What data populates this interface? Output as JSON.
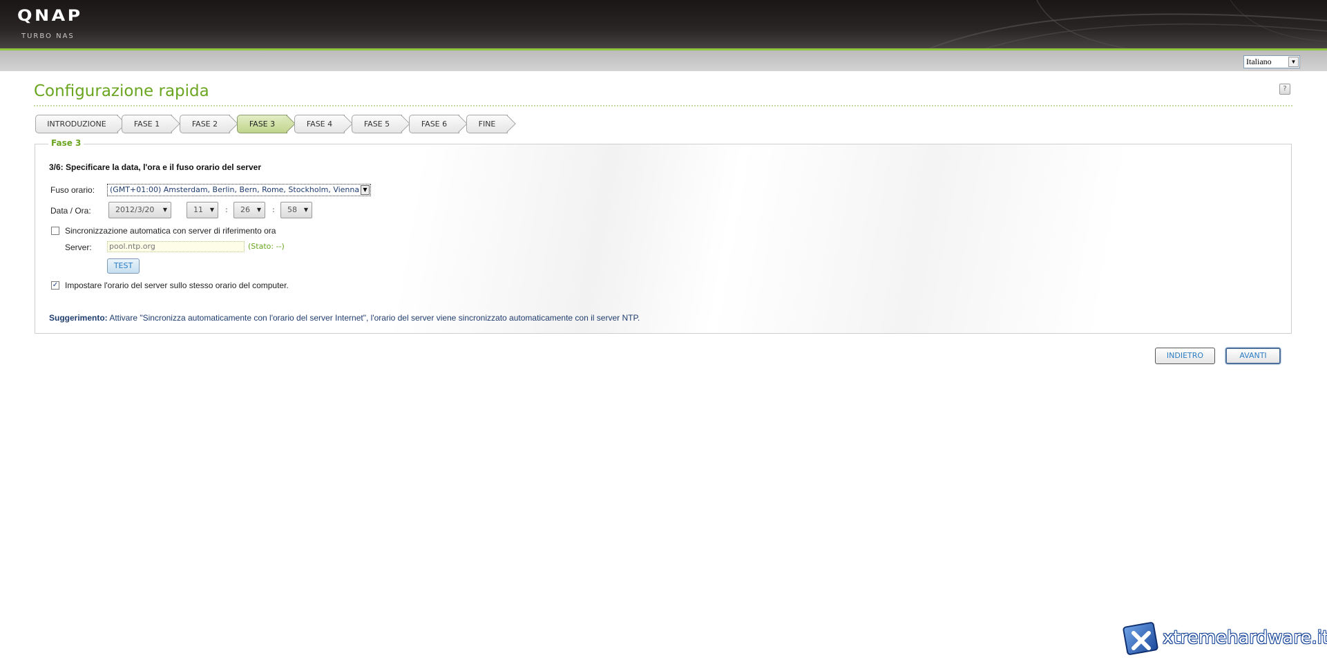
{
  "header": {
    "logo": "QNAP",
    "logo_sub": "TURBO NAS"
  },
  "language": {
    "selected": "Italiano"
  },
  "page_title": "Configurazione rapida",
  "steps": [
    {
      "label": "INTRODUZIONE",
      "active": false
    },
    {
      "label": "FASE 1",
      "active": false
    },
    {
      "label": "FASE 2",
      "active": false
    },
    {
      "label": "FASE 3",
      "active": true
    },
    {
      "label": "FASE 4",
      "active": false
    },
    {
      "label": "FASE 5",
      "active": false
    },
    {
      "label": "FASE 6",
      "active": false
    },
    {
      "label": "FINE",
      "active": false
    }
  ],
  "panel": {
    "legend": "Fase 3",
    "instruction": "3/6: Specificare la data, l'ora e il fuso orario del server",
    "timezone_label": "Fuso orario:",
    "timezone_value": "(GMT+01:00) Amsterdam, Berlin, Bern, Rome, Stockholm, Vienna",
    "datetime_label": "Data / Ora:",
    "date_value": "2012/3/20",
    "hour_value": "11",
    "minute_value": "26",
    "second_value": "58",
    "sync_label": "Sincronizzazione automatica con server di riferimento ora",
    "sync_checked": false,
    "server_label": "Server:",
    "server_value": "pool.ntp.org",
    "server_status": "(Stato: --)",
    "test_label": "TEST",
    "same_time_label": "Impostare l'orario del server sullo stesso orario del computer.",
    "same_time_checked": true,
    "hint_label": "Suggerimento:",
    "hint_text": "Attivare \"Sincronizza automaticamente con l'orario del server Internet\", l'orario del server viene sincronizzato automaticamente con il server NTP."
  },
  "buttons": {
    "back": "INDIETRO",
    "next": "AVANTI"
  },
  "watermark": "xtremehardware.it",
  "colors": {
    "accent_green": "#6aa520",
    "link_blue": "#2a7cc4",
    "header_dark": "#1a1616"
  }
}
